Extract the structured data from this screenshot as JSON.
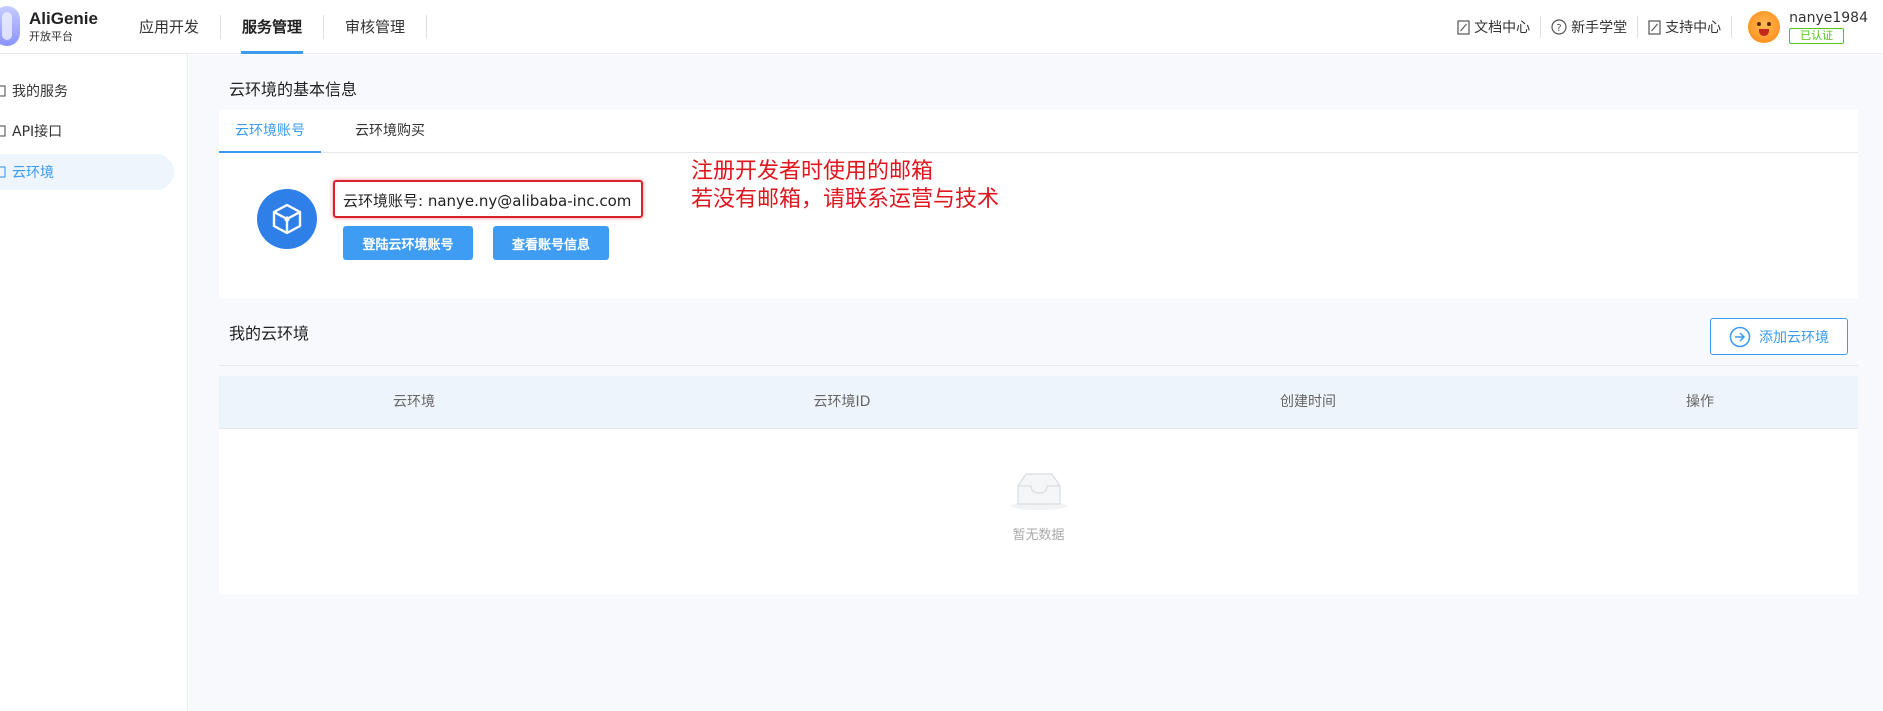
{
  "header": {
    "logo_title": "AliGenie",
    "logo_subtitle": "开放平台",
    "nav": [
      "应用开发",
      "服务管理",
      "审核管理"
    ],
    "active_nav": "服务管理",
    "links": [
      "文档中心",
      "新手学堂",
      "支持中心"
    ],
    "username": "nanye1984",
    "cert_badge": "已认证"
  },
  "sidebar": {
    "items": [
      "我的服务",
      "API接口",
      "云环境"
    ],
    "active": "云环境"
  },
  "main": {
    "section_title": "云环境的基本信息",
    "tabs": [
      "云环境账号",
      "云环境购买"
    ],
    "account_text": "云环境账号: nanye.ny@alibaba-inc.com",
    "login_button": "登陆云环境账号",
    "view_button": "查看账号信息",
    "annotation_line1": "注册开发者时使用的邮箱",
    "annotation_line2": "若没有邮箱，请联系运营与技术",
    "my_title": "我的云环境",
    "add_button": "添加云环境",
    "table": {
      "columns": [
        "云环境",
        "云环境ID",
        "创建时间",
        "操作"
      ],
      "empty_text": "暂无数据"
    }
  },
  "colors": {
    "accent": "#3a9bf0",
    "annotation": "#e0161f",
    "verified": "#52c41a"
  }
}
